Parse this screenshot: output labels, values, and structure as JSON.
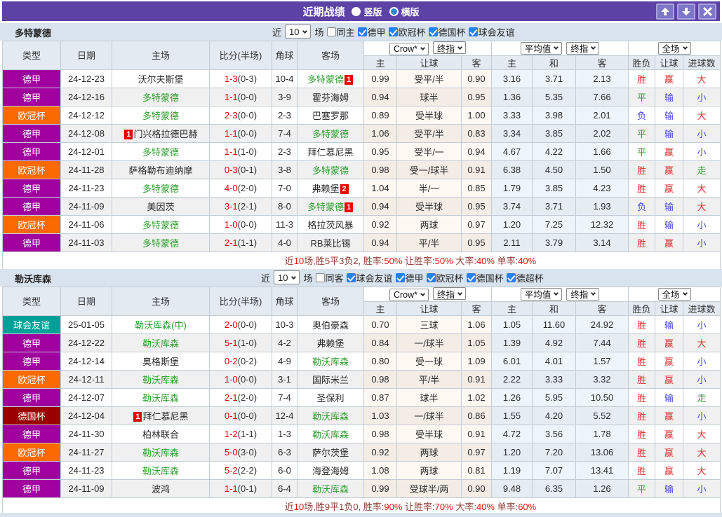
{
  "titlebar": {
    "title": "近期战绩",
    "radios": [
      {
        "label": "竖版",
        "selected": false
      },
      {
        "label": "横版",
        "selected": true
      }
    ],
    "buttons": {
      "up_icon": "up-arrow",
      "down_icon": "down-arrow",
      "close_icon": "close-x"
    }
  },
  "palette": {
    "德甲": "#a0009e",
    "欧冠杯": "#fb6a00",
    "德国杯": "#990000",
    "球会友谊": "#00a099"
  },
  "table_header": {
    "left": [
      "类型",
      "日期",
      "主场",
      "比分(半场)",
      "角球",
      "客场"
    ],
    "groups": [
      {
        "dds": [
          "Crow*",
          "终指"
        ],
        "subs": [
          "主",
          "让球",
          "客"
        ]
      },
      {
        "dds": [
          "平均值",
          "终指"
        ],
        "subs": [
          "主",
          "和",
          "客"
        ]
      },
      {
        "dds": [
          "全场"
        ],
        "subs": [
          "胜负",
          "让球",
          "进球数"
        ]
      }
    ]
  },
  "sections": [
    {
      "team": "多特蒙德",
      "filter": {
        "near": "近",
        "count": "10",
        "games": "场",
        "same_label": "同主",
        "same_checked": false,
        "leagues": [
          "德甲",
          "欧冠杯",
          "德国杯",
          "球会友谊"
        ]
      },
      "rows": [
        {
          "comp": "德甲",
          "date": "24-12-23",
          "home": {
            "name": "沃尔夫斯堡"
          },
          "score": "1-3",
          "half": "(0-3)",
          "corner": "10-4",
          "away": {
            "name": "多特蒙德",
            "green": true,
            "badge_after": "1"
          },
          "crow": [
            "0.99",
            "受平/半",
            "0.90"
          ],
          "euro": [
            "3.16",
            "3.71",
            "2.13"
          ],
          "res": [
            [
              "胜",
              "r"
            ],
            [
              "赢",
              "r"
            ],
            [
              "大",
              "r"
            ]
          ]
        },
        {
          "comp": "德甲",
          "date": "24-12-16",
          "home": {
            "name": "多特蒙德",
            "green": true
          },
          "score": "1-1",
          "half": "(0-0)",
          "corner": "3-9",
          "away": {
            "name": "霍芬海姆"
          },
          "crow": [
            "0.94",
            "球半",
            "0.95"
          ],
          "euro": [
            "1.36",
            "5.35",
            "7.66"
          ],
          "res": [
            [
              "平",
              "g"
            ],
            [
              "输",
              "b"
            ],
            [
              "小",
              "b"
            ]
          ]
        },
        {
          "comp": "欧冠杯",
          "date": "24-12-12",
          "home": {
            "name": "多特蒙德",
            "green": true
          },
          "score": "2-3",
          "half": "(0-0)",
          "corner": "2-3",
          "away": {
            "name": "巴塞罗那"
          },
          "crow": [
            "0.89",
            "受半球",
            "1.00"
          ],
          "euro": [
            "3.33",
            "3.98",
            "2.01"
          ],
          "res": [
            [
              "负",
              "b"
            ],
            [
              "输",
              "b"
            ],
            [
              "大",
              "r"
            ]
          ]
        },
        {
          "comp": "德甲",
          "date": "24-12-08",
          "home": {
            "name": "门兴格拉德巴赫",
            "badge_before": "1"
          },
          "score": "1-1",
          "half": "(0-0)",
          "corner": "7-4",
          "away": {
            "name": "多特蒙德",
            "green": true
          },
          "crow": [
            "1.06",
            "受平/半",
            "0.83"
          ],
          "euro": [
            "3.34",
            "3.85",
            "2.02"
          ],
          "res": [
            [
              "平",
              "g"
            ],
            [
              "输",
              "b"
            ],
            [
              "小",
              "b"
            ]
          ]
        },
        {
          "comp": "德甲",
          "date": "24-12-01",
          "home": {
            "name": "多特蒙德",
            "green": true
          },
          "score": "1-1",
          "half": "(1-0)",
          "corner": "2-3",
          "away": {
            "name": "拜仁慕尼黑"
          },
          "crow": [
            "0.95",
            "受半/一",
            "0.94"
          ],
          "euro": [
            "4.67",
            "4.22",
            "1.66"
          ],
          "res": [
            [
              "平",
              "g"
            ],
            [
              "赢",
              "r"
            ],
            [
              "小",
              "b"
            ]
          ]
        },
        {
          "comp": "欧冠杯",
          "date": "24-11-28",
          "home": {
            "name": "萨格勒布迪纳摩"
          },
          "score": "0-3",
          "half": "(0-1)",
          "corner": "3-8",
          "away": {
            "name": "多特蒙德",
            "green": true
          },
          "crow": [
            "0.98",
            "受一/球半",
            "0.91"
          ],
          "euro": [
            "6.38",
            "4.50",
            "1.50"
          ],
          "res": [
            [
              "胜",
              "r"
            ],
            [
              "赢",
              "r"
            ],
            [
              "走",
              "g"
            ]
          ]
        },
        {
          "comp": "德甲",
          "date": "24-11-23",
          "home": {
            "name": "多特蒙德",
            "green": true
          },
          "score": "4-0",
          "half": "(2-0)",
          "corner": "7-0",
          "away": {
            "name": "弗赖堡",
            "badge_after": "2"
          },
          "crow": [
            "1.04",
            "半/一",
            "0.85"
          ],
          "euro": [
            "1.79",
            "3.85",
            "4.23"
          ],
          "res": [
            [
              "胜",
              "r"
            ],
            [
              "赢",
              "r"
            ],
            [
              "大",
              "r"
            ]
          ]
        },
        {
          "comp": "德甲",
          "date": "24-11-09",
          "home": {
            "name": "美因茨"
          },
          "score": "3-1",
          "half": "(2-1)",
          "corner": "8-0",
          "away": {
            "name": "多特蒙德",
            "green": true,
            "badge_after": "1"
          },
          "crow": [
            "0.94",
            "受半球",
            "0.95"
          ],
          "euro": [
            "3.74",
            "3.71",
            "1.93"
          ],
          "res": [
            [
              "负",
              "b"
            ],
            [
              "输",
              "b"
            ],
            [
              "大",
              "r"
            ]
          ]
        },
        {
          "comp": "欧冠杯",
          "date": "24-11-06",
          "home": {
            "name": "多特蒙德",
            "green": true
          },
          "score": "1-0",
          "half": "(0-0)",
          "corner": "11-3",
          "away": {
            "name": "格拉茨风暴"
          },
          "crow": [
            "0.92",
            "两球",
            "0.97"
          ],
          "euro": [
            "1.20",
            "7.25",
            "12.32"
          ],
          "res": [
            [
              "胜",
              "r"
            ],
            [
              "输",
              "b"
            ],
            [
              "小",
              "b"
            ]
          ]
        },
        {
          "comp": "德甲",
          "date": "24-11-03",
          "home": {
            "name": "多特蒙德",
            "green": true
          },
          "score": "2-1",
          "half": "(1-1)",
          "corner": "4-0",
          "away": {
            "name": "RB莱比锡"
          },
          "crow": [
            "0.94",
            "平/半",
            "0.95"
          ],
          "euro": [
            "2.11",
            "3.79",
            "3.14"
          ],
          "res": [
            [
              "胜",
              "r"
            ],
            [
              "赢",
              "r"
            ],
            [
              "小",
              "b"
            ]
          ]
        }
      ],
      "summary": [
        {
          "t": "近",
          "r": false
        },
        {
          "t": "10",
          "r": true
        },
        {
          "t": "场,胜5平3负2, 胜率:",
          "r": false
        },
        {
          "t": "50%",
          "r": true
        },
        {
          "t": " 让胜率:",
          "r": false
        },
        {
          "t": "50%",
          "r": true
        },
        {
          "t": " 大率:",
          "r": false
        },
        {
          "t": "40%",
          "r": true
        },
        {
          "t": " 单率:",
          "r": false
        },
        {
          "t": "40%",
          "r": true
        }
      ]
    },
    {
      "team": "勒沃库森",
      "filter": {
        "near": "近",
        "count": "10",
        "games": "场",
        "same_label": "同客",
        "same_checked": false,
        "leagues": [
          "球会友谊",
          "德甲",
          "欧冠杯",
          "德国杯",
          "德超杯"
        ]
      },
      "rows": [
        {
          "comp": "球会友谊",
          "date": "25-01-05",
          "home": {
            "name": "勒沃库森(中)",
            "green": true
          },
          "score": "2-0",
          "half": "(0-0)",
          "corner": "10-3",
          "away": {
            "name": "奥伯豪森"
          },
          "crow": [
            "0.70",
            "三球",
            "1.06"
          ],
          "euro": [
            "1.05",
            "11.60",
            "24.92"
          ],
          "res": [
            [
              "胜",
              "r"
            ],
            [
              "输",
              "b"
            ],
            [
              "小",
              "b"
            ]
          ]
        },
        {
          "comp": "德甲",
          "date": "24-12-22",
          "home": {
            "name": "勒沃库森",
            "green": true
          },
          "score": "5-1",
          "half": "(1-0)",
          "corner": "4-2",
          "away": {
            "name": "弗赖堡"
          },
          "crow": [
            "0.84",
            "一/球半",
            "1.05"
          ],
          "euro": [
            "1.39",
            "4.92",
            "7.44"
          ],
          "res": [
            [
              "胜",
              "r"
            ],
            [
              "赢",
              "r"
            ],
            [
              "大",
              "r"
            ]
          ]
        },
        {
          "comp": "德甲",
          "date": "24-12-14",
          "home": {
            "name": "奥格斯堡"
          },
          "score": "0-2",
          "half": "(0-2)",
          "corner": "4-9",
          "away": {
            "name": "勒沃库森",
            "green": true
          },
          "crow": [
            "0.80",
            "受一球",
            "1.09"
          ],
          "euro": [
            "6.01",
            "4.01",
            "1.57"
          ],
          "res": [
            [
              "胜",
              "r"
            ],
            [
              "赢",
              "r"
            ],
            [
              "小",
              "b"
            ]
          ]
        },
        {
          "comp": "欧冠杯",
          "date": "24-12-11",
          "home": {
            "name": "勒沃库森",
            "green": true
          },
          "score": "1-0",
          "half": "(0-0)",
          "corner": "3-1",
          "away": {
            "name": "国际米兰"
          },
          "crow": [
            "0.98",
            "平/半",
            "0.91"
          ],
          "euro": [
            "2.22",
            "3.33",
            "3.32"
          ],
          "res": [
            [
              "胜",
              "r"
            ],
            [
              "赢",
              "r"
            ],
            [
              "小",
              "b"
            ]
          ]
        },
        {
          "comp": "德甲",
          "date": "24-12-07",
          "home": {
            "name": "勒沃库森",
            "green": true
          },
          "score": "2-1",
          "half": "(2-0)",
          "corner": "7-4",
          "away": {
            "name": "圣保利"
          },
          "crow": [
            "0.87",
            "球半",
            "1.02"
          ],
          "euro": [
            "1.26",
            "5.95",
            "10.50"
          ],
          "res": [
            [
              "胜",
              "r"
            ],
            [
              "输",
              "b"
            ],
            [
              "走",
              "g"
            ]
          ]
        },
        {
          "comp": "德国杯",
          "date": "24-12-04",
          "home": {
            "name": "拜仁慕尼黑",
            "badge_before": "1"
          },
          "score": "0-1",
          "half": "(0-0)",
          "corner": "12-4",
          "away": {
            "name": "勒沃库森",
            "green": true
          },
          "crow": [
            "1.03",
            "一/球半",
            "0.86"
          ],
          "euro": [
            "1.55",
            "4.20",
            "5.52"
          ],
          "res": [
            [
              "胜",
              "r"
            ],
            [
              "赢",
              "r"
            ],
            [
              "小",
              "b"
            ]
          ]
        },
        {
          "comp": "德甲",
          "date": "24-11-30",
          "home": {
            "name": "柏林联合"
          },
          "score": "1-2",
          "half": "(1-1)",
          "corner": "1-3",
          "away": {
            "name": "勒沃库森",
            "green": true
          },
          "crow": [
            "0.98",
            "受半球",
            "0.91"
          ],
          "euro": [
            "4.72",
            "3.56",
            "1.78"
          ],
          "res": [
            [
              "胜",
              "r"
            ],
            [
              "赢",
              "r"
            ],
            [
              "大",
              "r"
            ]
          ]
        },
        {
          "comp": "欧冠杯",
          "date": "24-11-27",
          "home": {
            "name": "勒沃库森",
            "green": true
          },
          "score": "5-0",
          "half": "(3-0)",
          "corner": "6-3",
          "away": {
            "name": "萨尔茨堡"
          },
          "crow": [
            "0.92",
            "两球",
            "0.97"
          ],
          "euro": [
            "1.20",
            "7.20",
            "13.06"
          ],
          "res": [
            [
              "胜",
              "r"
            ],
            [
              "赢",
              "r"
            ],
            [
              "大",
              "r"
            ]
          ]
        },
        {
          "comp": "德甲",
          "date": "24-11-23",
          "home": {
            "name": "勒沃库森",
            "green": true
          },
          "score": "5-2",
          "half": "(2-2)",
          "corner": "6-0",
          "away": {
            "name": "海登海姆"
          },
          "crow": [
            "1.08",
            "两球",
            "0.81"
          ],
          "euro": [
            "1.19",
            "7.07",
            "13.41"
          ],
          "res": [
            [
              "胜",
              "r"
            ],
            [
              "赢",
              "r"
            ],
            [
              "大",
              "r"
            ]
          ]
        },
        {
          "comp": "德甲",
          "date": "24-11-09",
          "home": {
            "name": "波鸿"
          },
          "score": "1-1",
          "half": "(0-1)",
          "corner": "6-4",
          "away": {
            "name": "勒沃库森",
            "green": true
          },
          "crow": [
            "0.99",
            "受球半/两",
            "0.90"
          ],
          "euro": [
            "9.48",
            "6.35",
            "1.26"
          ],
          "res": [
            [
              "平",
              "g"
            ],
            [
              "输",
              "b"
            ],
            [
              "小",
              "b"
            ]
          ]
        }
      ],
      "summary": [
        {
          "t": "近",
          "r": false
        },
        {
          "t": "10",
          "r": true
        },
        {
          "t": "场,胜9平1负0, 胜率:",
          "r": false
        },
        {
          "t": "90%",
          "r": true
        },
        {
          "t": " 让胜率:",
          "r": false
        },
        {
          "t": "70%",
          "r": true
        },
        {
          "t": " 大率:",
          "r": false
        },
        {
          "t": "40%",
          "r": true
        },
        {
          "t": " 单率:",
          "r": false
        },
        {
          "t": "60%",
          "r": true
        }
      ]
    }
  ]
}
